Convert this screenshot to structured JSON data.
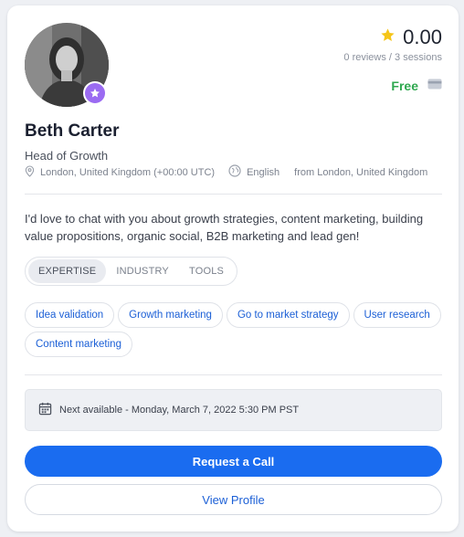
{
  "profile": {
    "name": "Beth Carter",
    "title": "Head of Growth",
    "location": "London, United Kingdom (+00:00 UTC)",
    "language": "English",
    "from": "from London, United Kingdom",
    "bio": "I'd love to chat with you about growth strategies, content marketing, building value propositions, organic social, B2B marketing and lead gen!"
  },
  "stats": {
    "rating": "0.00",
    "reviews": "0 reviews / 3 sessions",
    "price": "Free"
  },
  "tabs": [
    {
      "label": "EXPERTISE",
      "active": true
    },
    {
      "label": "INDUSTRY",
      "active": false
    },
    {
      "label": "TOOLS",
      "active": false
    }
  ],
  "chips": [
    "Idea validation",
    "Growth marketing",
    "Go to market strategy",
    "User research",
    "Content marketing"
  ],
  "availability": "Next available - Monday, March 7, 2022 5:30 PM PST",
  "actions": {
    "request_label": "Request a Call",
    "view_label": "View Profile"
  },
  "icons": {
    "star": "star-icon",
    "card": "credit-card-icon",
    "location": "location-pin-icon",
    "language": "globe-icon",
    "calendar": "calendar-icon",
    "badge": "star-badge-icon"
  },
  "colors": {
    "primary": "#1a6cf0",
    "link": "#1b5fd6",
    "free": "#2fa84f",
    "star": "#f5c518",
    "badge": "#9b6bf2"
  }
}
